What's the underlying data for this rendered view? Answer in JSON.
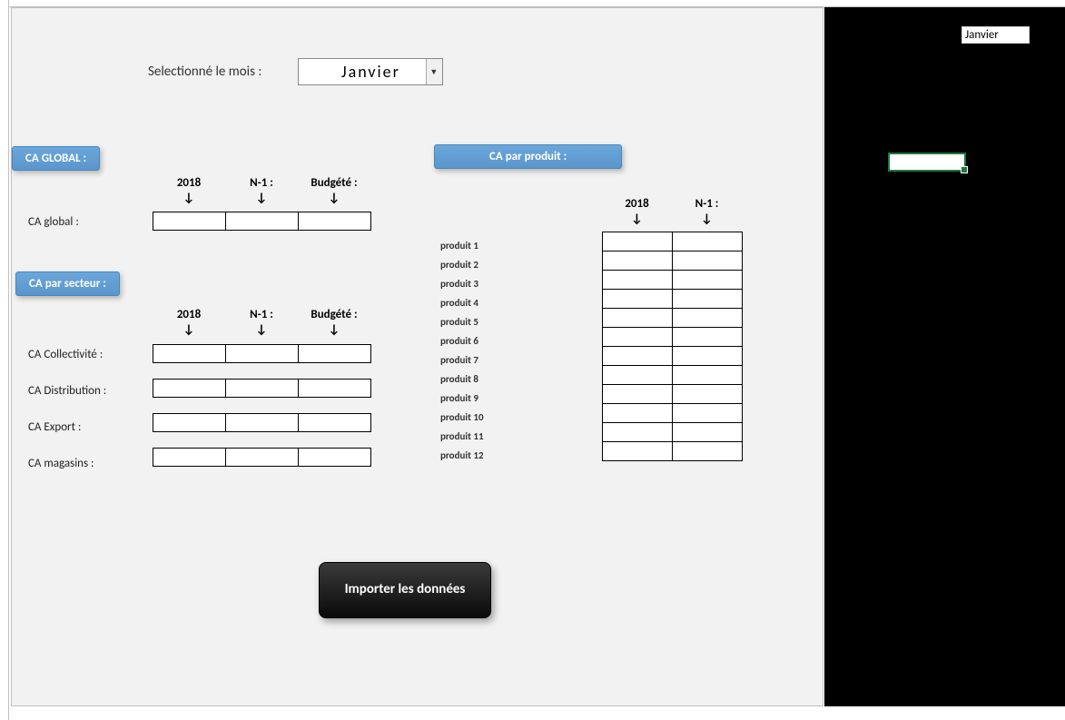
{
  "month_selector": {
    "label": "Selectionné le mois :",
    "value": "Janvier"
  },
  "badges": {
    "global": "CA GLOBAL :",
    "secteur": "CA par secteur :",
    "produit": "CA par produit :"
  },
  "columns": {
    "col1": "2018",
    "col2": "N-1 :",
    "col3": "Budgété :"
  },
  "arrow": "↓",
  "global": {
    "row_label": "CA global :",
    "cells": [
      "",
      "",
      ""
    ]
  },
  "secteur": {
    "rows": [
      {
        "label": "CA Collectivité :",
        "cells": [
          "",
          "",
          ""
        ]
      },
      {
        "label": "CA Distribution :",
        "cells": [
          "",
          "",
          ""
        ]
      },
      {
        "label": "CA Export :",
        "cells": [
          "",
          "",
          ""
        ]
      },
      {
        "label": "CA magasins :",
        "cells": [
          "",
          "",
          ""
        ]
      }
    ]
  },
  "produit": {
    "columns": {
      "col1": "2018",
      "col2": "N-1 :"
    },
    "rows": [
      {
        "label": "produit 1",
        "cells": [
          "",
          ""
        ]
      },
      {
        "label": "produit 2",
        "cells": [
          "",
          ""
        ]
      },
      {
        "label": "produit 3",
        "cells": [
          "",
          ""
        ]
      },
      {
        "label": "produit 4",
        "cells": [
          "",
          ""
        ]
      },
      {
        "label": "produit 5",
        "cells": [
          "",
          ""
        ]
      },
      {
        "label": "produit 6",
        "cells": [
          "",
          ""
        ]
      },
      {
        "label": "produit 7",
        "cells": [
          "",
          ""
        ]
      },
      {
        "label": "produit 8",
        "cells": [
          "",
          ""
        ]
      },
      {
        "label": "produit 9",
        "cells": [
          "",
          ""
        ]
      },
      {
        "label": "produit 10",
        "cells": [
          "",
          ""
        ]
      },
      {
        "label": "produit 11",
        "cells": [
          "",
          ""
        ]
      },
      {
        "label": "produit 12",
        "cells": [
          "",
          ""
        ]
      }
    ]
  },
  "import_button_label": "Importer les données",
  "right_panel": {
    "cell_value": "Janvier"
  }
}
